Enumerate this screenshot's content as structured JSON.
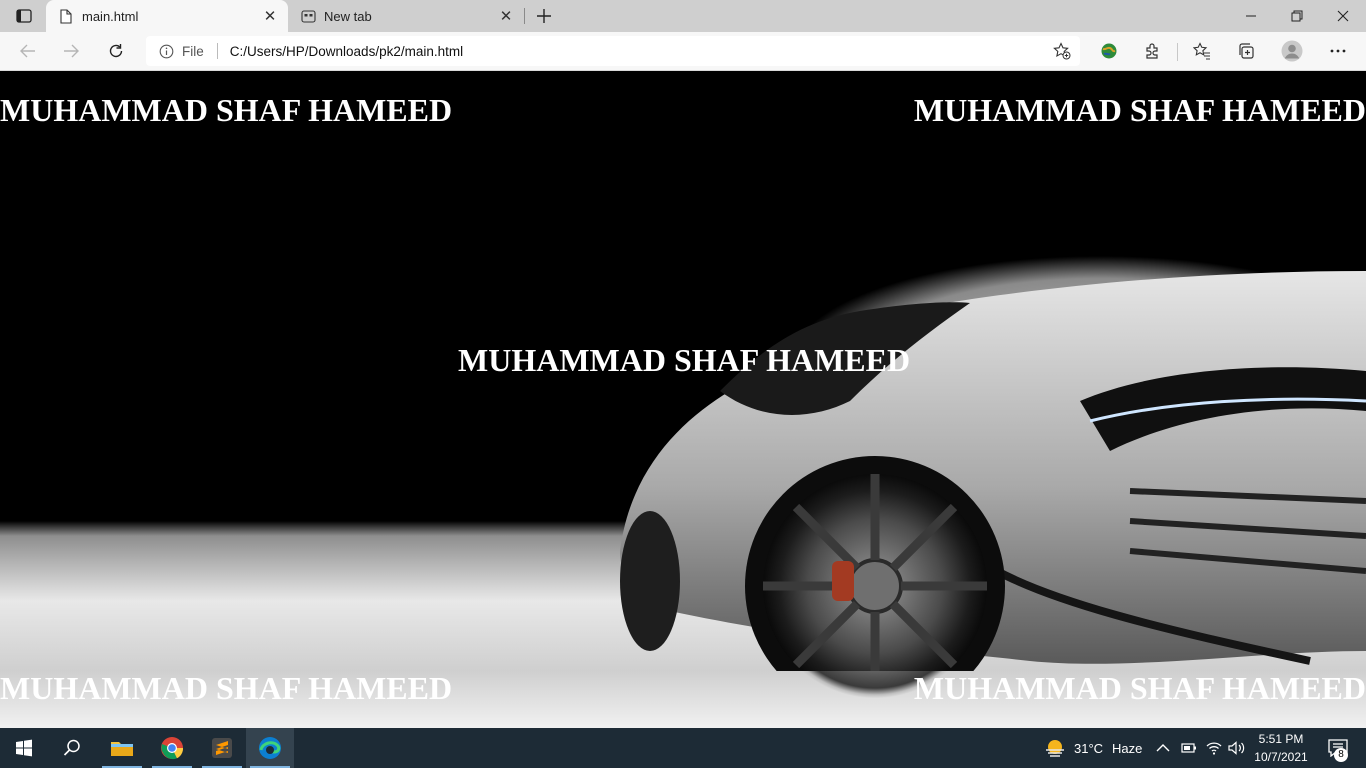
{
  "browser": {
    "tabs": [
      {
        "title": "main.html",
        "active": true
      },
      {
        "title": "New tab",
        "active": false
      }
    ],
    "address": {
      "scheme_label": "File",
      "url": "C:/Users/HP/Downloads/pk2/main.html"
    }
  },
  "page": {
    "headings": [
      "MUHAMMAD SHAF HAMEED",
      "MUHAMMAD SHAF HAMEED",
      "MUHAMMAD SHAF HAMEED",
      "MUHAMMAD SHAF HAMEED",
      "MUHAMMAD SHAF HAMEED"
    ],
    "background": "white sports car on black backdrop"
  },
  "taskbar": {
    "pinned": [
      "windows-start-icon",
      "search-icon",
      "file-explorer-icon",
      "chrome-icon",
      "sublime-text-icon",
      "edge-icon"
    ],
    "weather": {
      "temp": "31°C",
      "desc": "Haze"
    },
    "clock": {
      "time": "5:51 PM",
      "date": "10/7/2021"
    },
    "notifications": "8"
  },
  "colors": {
    "tabbar": "#cfcfcf",
    "navbar": "#f7f7f7",
    "taskbar": "#1d2b36",
    "heading": "#ffffff"
  }
}
